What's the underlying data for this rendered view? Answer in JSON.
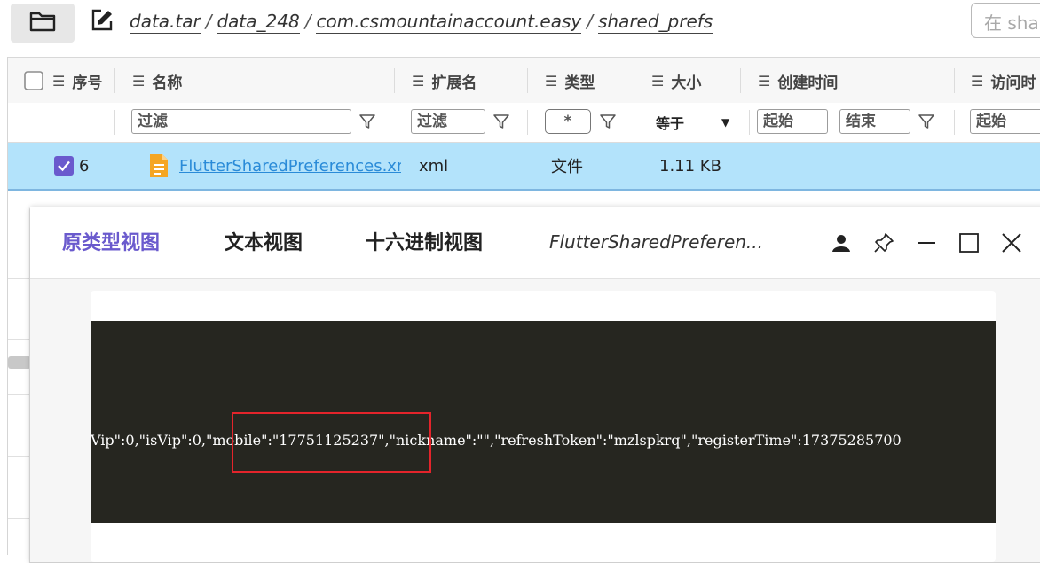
{
  "breadcrumb": [
    "data.tar",
    "data_248",
    "com.csmountainaccount.easy",
    "shared_prefs"
  ],
  "search": {
    "placeholder": "在 sha"
  },
  "table": {
    "columns": [
      {
        "label": "序号"
      },
      {
        "label": "名称"
      },
      {
        "label": "扩展名"
      },
      {
        "label": "类型"
      },
      {
        "label": "大小"
      },
      {
        "label": "创建时间"
      },
      {
        "label": "访问时"
      }
    ],
    "filters": {
      "name": "过滤",
      "ext": "过滤",
      "type": "*",
      "size_op": "等于",
      "created_start": "起始",
      "created_end": "结束",
      "accessed_start": "起始"
    },
    "rows": [
      {
        "index": "6",
        "name": "FlutterSharedPreferences.xml",
        "ext": "xml",
        "type": "文件",
        "size": "1.11 KB",
        "selected": true
      }
    ]
  },
  "dialog": {
    "tabs": [
      "原类型视图",
      "文本视图",
      "十六进制视图"
    ],
    "active_tab": 0,
    "title": "FlutterSharedPreferen...",
    "code_text": "Vip\":0,\"isVip\":0,\"mobile\":\"17751125237\",\"nickname\":\"\",\"refreshToken\":\"mzlspkrq\",\"registerTime\":17375285700",
    "highlight_text": "\"mobile\":\"17751125237\","
  },
  "colors": {
    "accent": "#6a5acd",
    "row_selected": "#b3e3fb",
    "code_bg": "#262620",
    "highlight": "#e3242b"
  }
}
